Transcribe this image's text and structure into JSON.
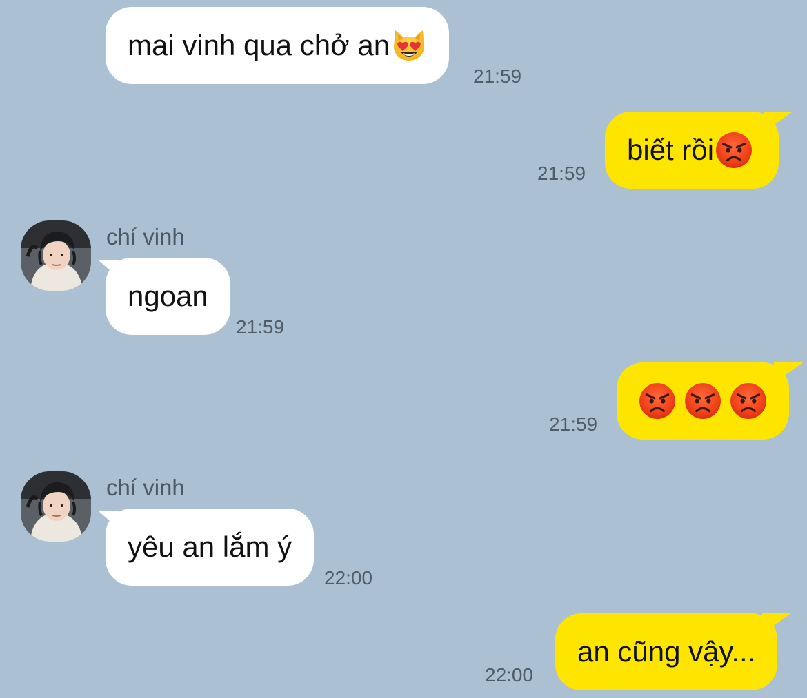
{
  "messages": [
    {
      "sender": "",
      "text": "mai vinh qua chở an",
      "emoji": "heart-eyes-cat-icon",
      "time": "21:59",
      "direction": "in"
    },
    {
      "sender": "",
      "text": "biết rồi",
      "emoji": "angry-face-icon",
      "time": "21:59",
      "direction": "out"
    },
    {
      "sender": "chí vinh",
      "text": "ngoan",
      "time": "21:59",
      "direction": "in"
    },
    {
      "sender": "",
      "text": "",
      "emoji": "angry-face-icon x3",
      "time": "21:59",
      "direction": "out"
    },
    {
      "sender": "chí vinh",
      "text": "yêu an lắm ý",
      "time": "22:00",
      "direction": "in"
    },
    {
      "sender": "",
      "text": "an cũng vậy...",
      "time": "22:00",
      "direction": "out"
    }
  ],
  "colors": {
    "background": "#abc1d3",
    "incoming_bubble": "#ffffff",
    "outgoing_bubble": "#fee500",
    "timestamp": "#4f5d69"
  }
}
